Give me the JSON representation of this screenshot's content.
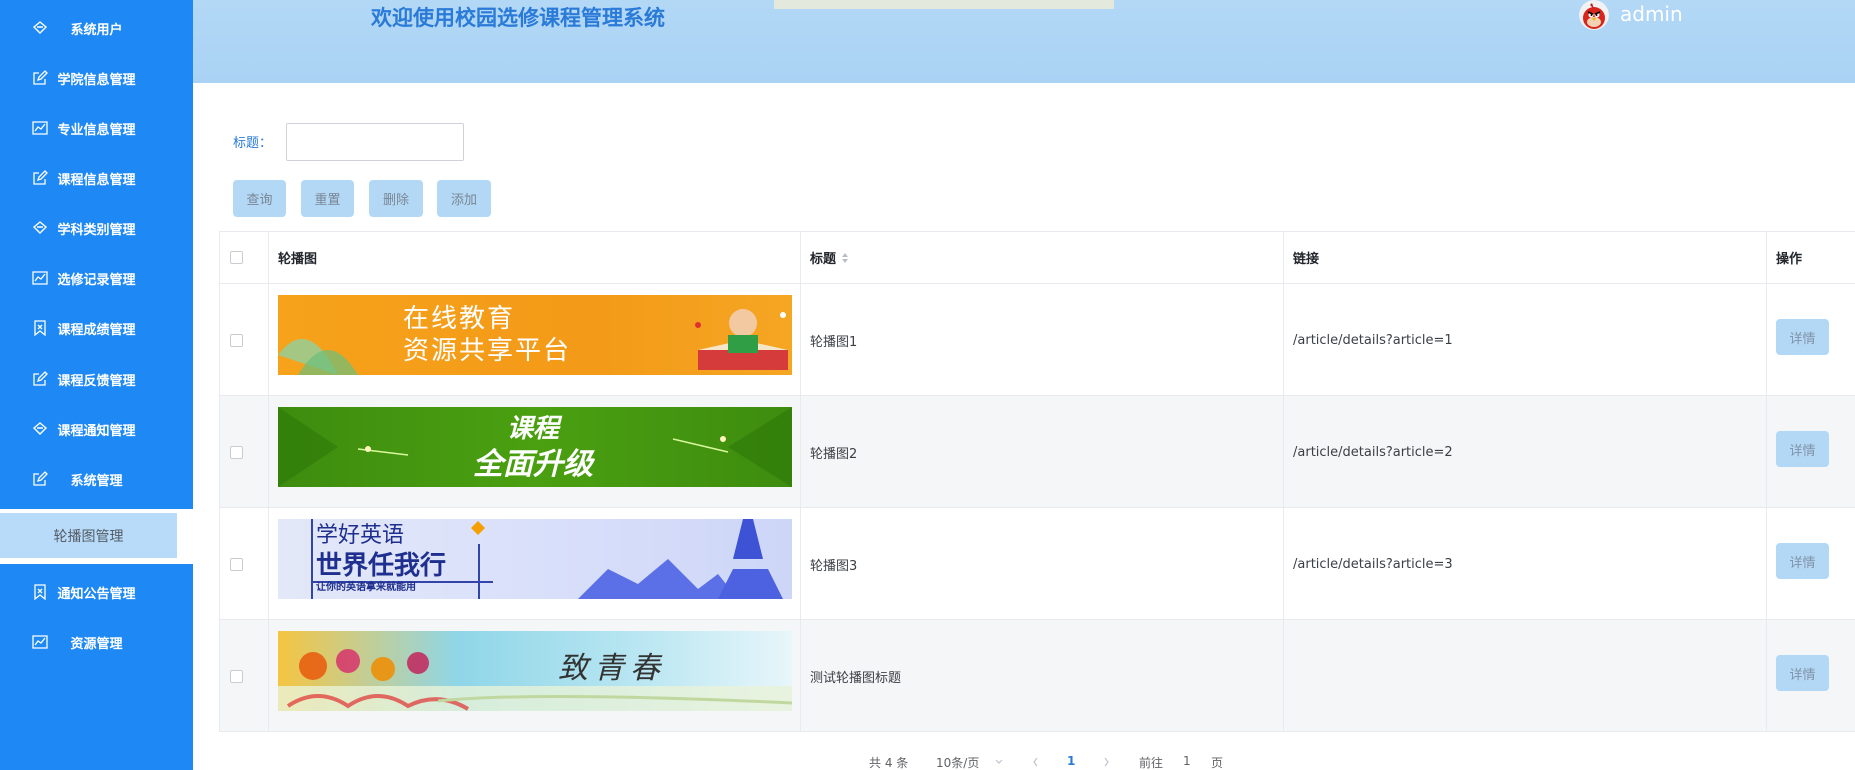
{
  "header": {
    "title": "欢迎使用校园选修课程管理系统",
    "username": "admin"
  },
  "sidebar": {
    "items": [
      {
        "label": "系统用户",
        "icon": "diamond-icon"
      },
      {
        "label": "学院信息管理",
        "icon": "edit-icon"
      },
      {
        "label": "专业信息管理",
        "icon": "chart-icon"
      },
      {
        "label": "课程信息管理",
        "icon": "edit-icon"
      },
      {
        "label": "学科类别管理",
        "icon": "diamond-icon"
      },
      {
        "label": "选修记录管理",
        "icon": "chart-icon"
      },
      {
        "label": "课程成绩管理",
        "icon": "bookmark-icon"
      },
      {
        "label": "课程反馈管理",
        "icon": "edit-icon"
      },
      {
        "label": "课程通知管理",
        "icon": "diamond-icon"
      },
      {
        "label": "系统管理",
        "icon": "edit-icon"
      },
      {
        "label": "通知公告管理",
        "icon": "bookmark-icon"
      },
      {
        "label": "资源管理",
        "icon": "chart-icon"
      }
    ],
    "submenu": {
      "label": "轮播图管理"
    }
  },
  "search": {
    "label": "标题：",
    "value": "",
    "placeholder": ""
  },
  "buttons": {
    "query": "查询",
    "reset": "重置",
    "delete": "删除",
    "add": "添加"
  },
  "table": {
    "columns": {
      "banner": "轮播图",
      "title": "标题",
      "link": "链接",
      "action": "操作"
    },
    "rows": [
      {
        "banner_text": [
          "在线教育",
          "资源共享平台"
        ],
        "title": "轮播图1",
        "link": "/article/details?article=1",
        "action": "详情"
      },
      {
        "banner_text": [
          "课程",
          "全面升级"
        ],
        "title": "轮播图2",
        "link": "/article/details?article=2",
        "action": "详情"
      },
      {
        "banner_text": [
          "学好英语",
          "世界任我行",
          "让你的英语拿来就能用"
        ],
        "title": "轮播图3",
        "link": "/article/details?article=3",
        "action": "详情"
      },
      {
        "banner_text": [
          "致青春"
        ],
        "title": "测试轮播图标题",
        "link": "",
        "action": "详情"
      }
    ]
  },
  "pagination": {
    "total": "共 4 条",
    "page_size": "10条/页",
    "current_page": "1",
    "goto_prefix": "前往",
    "goto_value": "1",
    "goto_suffix": "页"
  },
  "colors": {
    "sidebar": "#1e88f5",
    "header": "#b3d8f6",
    "accent": "#2a7ad8",
    "button": "#b3d8f6"
  }
}
